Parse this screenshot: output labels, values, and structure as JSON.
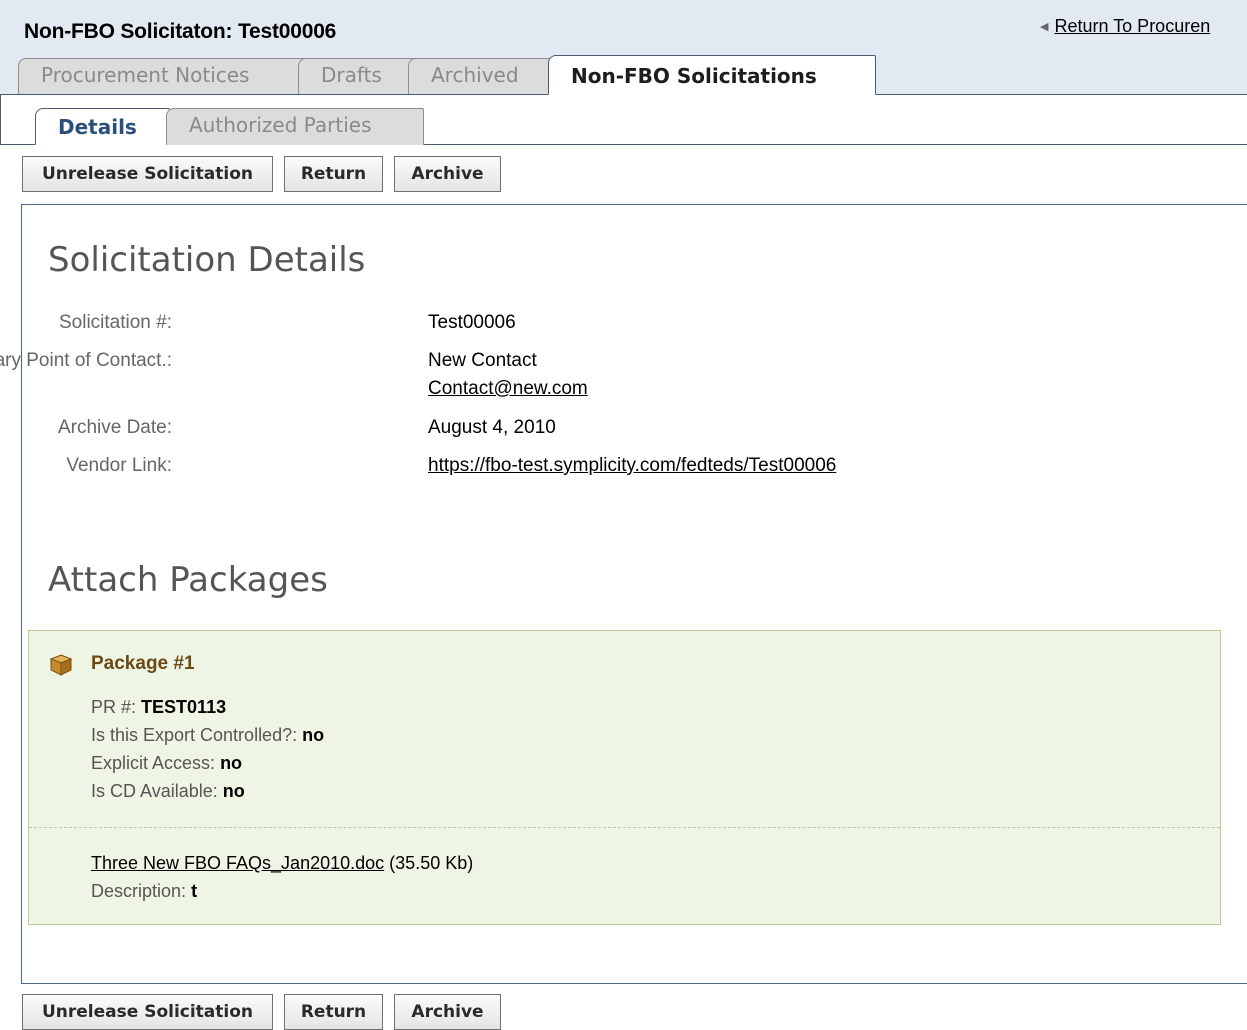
{
  "header": {
    "title": "Non-FBO Solicitaton: Test00006",
    "return_link": "Return To Procuren"
  },
  "main_tabs": [
    {
      "label": "Procurement Notices"
    },
    {
      "label": "Drafts"
    },
    {
      "label": "Archived"
    },
    {
      "label": "Non-FBO Solicitations"
    }
  ],
  "sub_tabs": [
    {
      "label": "Details"
    },
    {
      "label": "Authorized Parties"
    }
  ],
  "buttons": {
    "unrelease": "Unrelease Solicitation",
    "return": "Return",
    "archive": "Archive"
  },
  "details": {
    "section_title": "Solicitation Details",
    "solicitation_label": "Solicitation #:",
    "solicitation_value": "Test00006",
    "contact_label": "Primary Point of Contact.:",
    "contact_name": "New Contact",
    "contact_email": "Contact@new.com",
    "archive_label": "Archive Date:",
    "archive_value": "August 4, 2010",
    "vendor_label": "Vendor Link:",
    "vendor_value": "https://fbo-test.symplicity.com/fedteds/Test00006"
  },
  "attach": {
    "section_title": "Attach Packages",
    "package_title": "Package #1",
    "pr_label": "PR #:",
    "pr_value": "TEST0113",
    "export_label": "Is this Export Controlled?:",
    "export_value": "no",
    "explicit_label": "Explicit Access:",
    "explicit_value": "no",
    "cd_label": "Is CD Available:",
    "cd_value": "no",
    "file_name": "Three New FBO FAQs_Jan2010.doc",
    "file_size": "(35.50 Kb)",
    "description_label": "Description:",
    "description_value": "t"
  },
  "colors": {
    "header_bg": "#e3e9f3",
    "package_bg": "#eef5e4",
    "package_title": "#6b4a14",
    "active_subtab": "#2b4f7c"
  },
  "icons": {
    "package": "package-box-icon",
    "return": "left-triangle-icon"
  }
}
